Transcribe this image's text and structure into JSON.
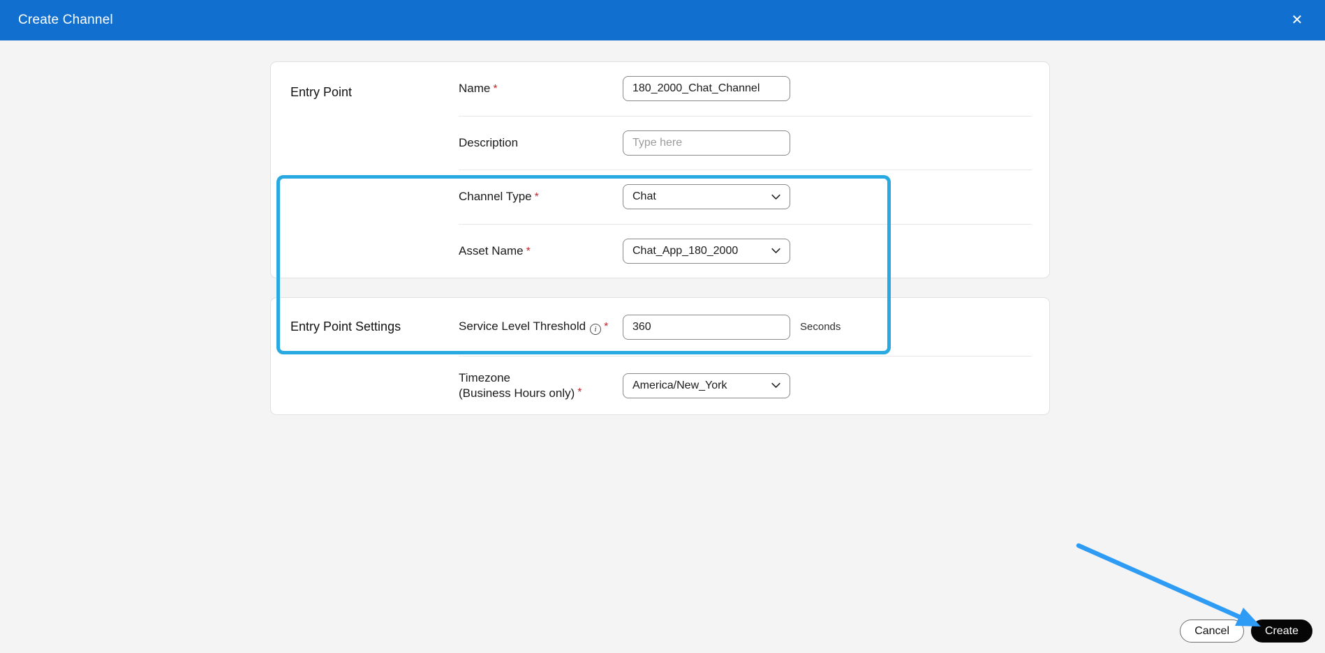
{
  "header": {
    "title": "Create Channel",
    "close_glyph": "✕",
    "bg_color": "#1170CF"
  },
  "misc": {
    "required_marker": "*",
    "info_glyph": "i"
  },
  "sections": [
    {
      "title": "Entry Point",
      "fields": [
        {
          "label": "Name",
          "required": true,
          "type": "input",
          "value": "180_2000_Chat_Channel"
        },
        {
          "label": "Description",
          "required": false,
          "type": "input",
          "placeholder": "Type here"
        },
        {
          "label": "Channel Type",
          "required": true,
          "type": "select",
          "value": "Chat"
        },
        {
          "label": "Asset Name",
          "required": true,
          "type": "select",
          "value": "Chat_App_180_2000"
        }
      ]
    },
    {
      "title": "Entry Point Settings",
      "fields": [
        {
          "label": "Service Level Threshold",
          "required": true,
          "has_info": true,
          "type": "input",
          "value": "360",
          "suffix": "Seconds"
        },
        {
          "label": "Timezone",
          "sublabel": "(Business Hours only)",
          "required": true,
          "type": "select",
          "value": "America/New_York"
        }
      ]
    }
  ],
  "footer": {
    "cancel_label": "Cancel",
    "create_label": "Create"
  },
  "annotation": {
    "highlight_color": "#29A9E1",
    "arrow_color": "#2E9BF4"
  }
}
